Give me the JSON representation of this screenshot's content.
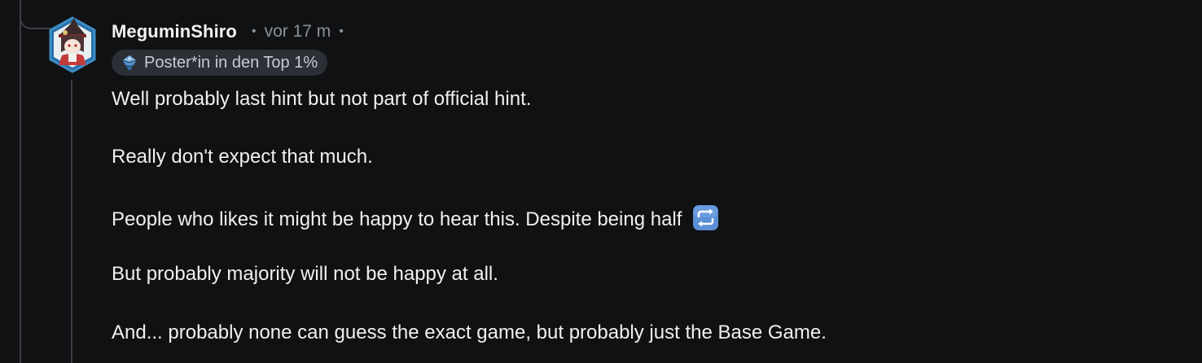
{
  "comment": {
    "username": "MeguminShiro",
    "separator": "•",
    "time_ago": "vor 17 m",
    "flair": "Poster*in in den Top 1%",
    "paragraphs": [
      "Well probably last hint but not part of official hint.",
      "Really don't expect that much.",
      "People who likes it might be happy to hear this. Despite being half",
      "But probably majority will not be happy at all.",
      "And... probably none can guess the exact game, but probably just the Base Game."
    ],
    "inline_emoji": "repeat-button-emoji"
  },
  "colors": {
    "background": "#101113",
    "text": "#eef0f2",
    "muted": "#8b9097",
    "flair_bg": "#2b3036",
    "thread_line": "#3a3d42",
    "emoji_blue": "#5b8fd6"
  }
}
